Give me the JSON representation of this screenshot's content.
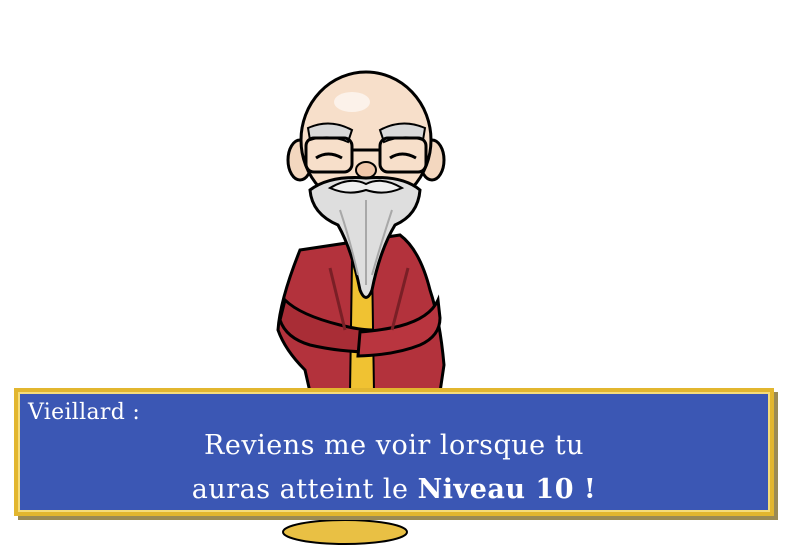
{
  "character": {
    "icon": "old-sage-character-icon"
  },
  "dialog": {
    "speaker": "Vieillard :",
    "line1": "Reviens me voir lorsque tu",
    "line2_prefix": "auras atteint le ",
    "line2_highlight": "Niveau 10 !"
  },
  "colors": {
    "dialog_background": "#3b57b4",
    "dialog_border": "#e2b62f",
    "text": "#ffffff",
    "robe": "#b3323c",
    "beard": "#dedede"
  }
}
